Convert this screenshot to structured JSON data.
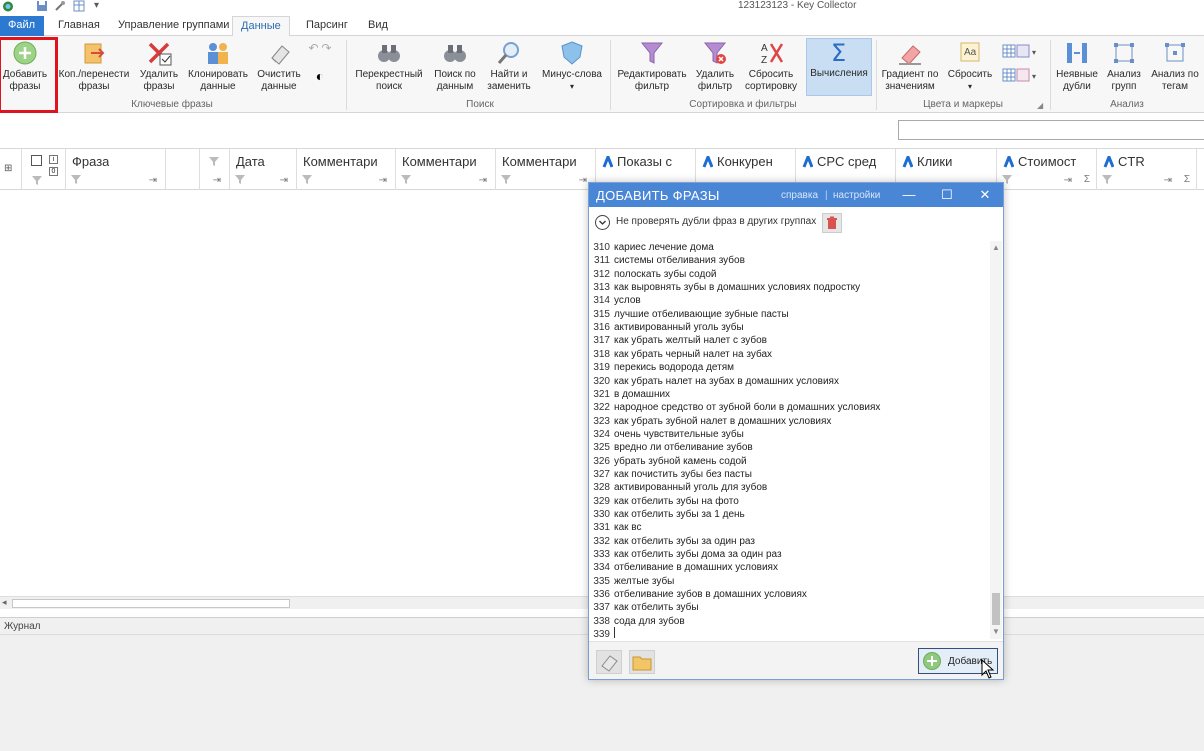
{
  "window": {
    "title": "123123123 - Key Collector"
  },
  "tabs": [
    {
      "label": "Файл"
    },
    {
      "label": "Главная"
    },
    {
      "label": "Управление группами"
    },
    {
      "label": "Данные"
    },
    {
      "label": "Парсинг"
    },
    {
      "label": "Вид"
    }
  ],
  "ribbon": {
    "buttons": {
      "add_phrases": "Добавить\nфразы",
      "copy_move": "Коп./перенести\nфразы",
      "delete_phrases": "Удалить\nфразы",
      "clone_data": "Клонировать\nданные",
      "clear_data": "Очистить\nданные",
      "cross_search": "Перекрестный\nпоиск",
      "search_data": "Поиск по\nданным",
      "find_replace": "Найти и\nзаменить",
      "minus_words": "Минус-слова",
      "edit_filter": "Редактировать\nфильтр",
      "delete_filter": "Удалить\nфильтр",
      "reset_sort": "Сбросить\nсортировку",
      "calculations": "Вычисления",
      "gradient": "Градиент по\nзначениям",
      "reset": "Сбросить",
      "implicit_dups": "Неявные\nдубли",
      "group_analysis": "Анализ\nгрупп",
      "tag_analysis": "Анализ по\nтегам"
    },
    "groups": {
      "keyphrases": "Ключевые фразы",
      "search": "Поиск",
      "sort_filter": "Сортировка и фильтры",
      "colors": "Цвета и маркеры",
      "analysis": "Анализ"
    }
  },
  "grid": {
    "columns": [
      "Фраза",
      "Дата",
      "Комментари",
      "Комментари",
      "Комментари",
      "Показы с",
      "Конкурен",
      "CPC сред",
      "Клики",
      "Стоимост",
      "CTR"
    ],
    "check_hint": "0"
  },
  "journal": {
    "label": "Журнал"
  },
  "dialog": {
    "title": "ДОБАВИТЬ ФРАЗЫ",
    "help_link": "справка",
    "settings_link": "настройки",
    "option_text": "Не проверять дубли фраз в других группах",
    "add_button": "Добавить",
    "lines": [
      {
        "n": "310",
        "text": "кариес лечение дома"
      },
      {
        "n": "311",
        "text": "системы отбеливания зубов"
      },
      {
        "n": "312",
        "text": "полоскать зубы содой"
      },
      {
        "n": "313",
        "text": "как выровнять зубы в домашних условиях подростку"
      },
      {
        "n": "314",
        "text": "услов"
      },
      {
        "n": "315",
        "text": "лучшие отбеливающие зубные пасты"
      },
      {
        "n": "316",
        "text": "активированный уголь зубы"
      },
      {
        "n": "317",
        "text": "как убрать желтый налет с зубов"
      },
      {
        "n": "318",
        "text": "как убрать черный налет на зубах"
      },
      {
        "n": "319",
        "text": "перекись водорода детям"
      },
      {
        "n": "320",
        "text": "как убрать налет на зубах в домашних условиях"
      },
      {
        "n": "321",
        "text": "в домашних"
      },
      {
        "n": "322",
        "text": "народное средство от зубной боли в домашних условиях"
      },
      {
        "n": "323",
        "text": "как убрать зубной налет в домашних условиях"
      },
      {
        "n": "324",
        "text": "очень чувствительные зубы"
      },
      {
        "n": "325",
        "text": "вредно ли отбеливание зубов"
      },
      {
        "n": "326",
        "text": "убрать зубной камень содой"
      },
      {
        "n": "327",
        "text": "как почистить зубы без пасты"
      },
      {
        "n": "328",
        "text": "активированный уголь для зубов"
      },
      {
        "n": "329",
        "text": "как отбелить зубы на фото"
      },
      {
        "n": "330",
        "text": "как отбелить зубы за 1 день"
      },
      {
        "n": "331",
        "text": "как вс"
      },
      {
        "n": "332",
        "text": "как отбелить зубы за один раз"
      },
      {
        "n": "333",
        "text": "как отбелить зубы дома за один раз"
      },
      {
        "n": "334",
        "text": "отбеливание в домашних условиях"
      },
      {
        "n": "335",
        "text": "желтые зубы"
      },
      {
        "n": "336",
        "text": "отбеливание зубов в домашних условиях"
      },
      {
        "n": "337",
        "text": "как отбелить зубы"
      },
      {
        "n": "338",
        "text": "сода для зубов"
      },
      {
        "n": "339",
        "text": ""
      }
    ]
  }
}
